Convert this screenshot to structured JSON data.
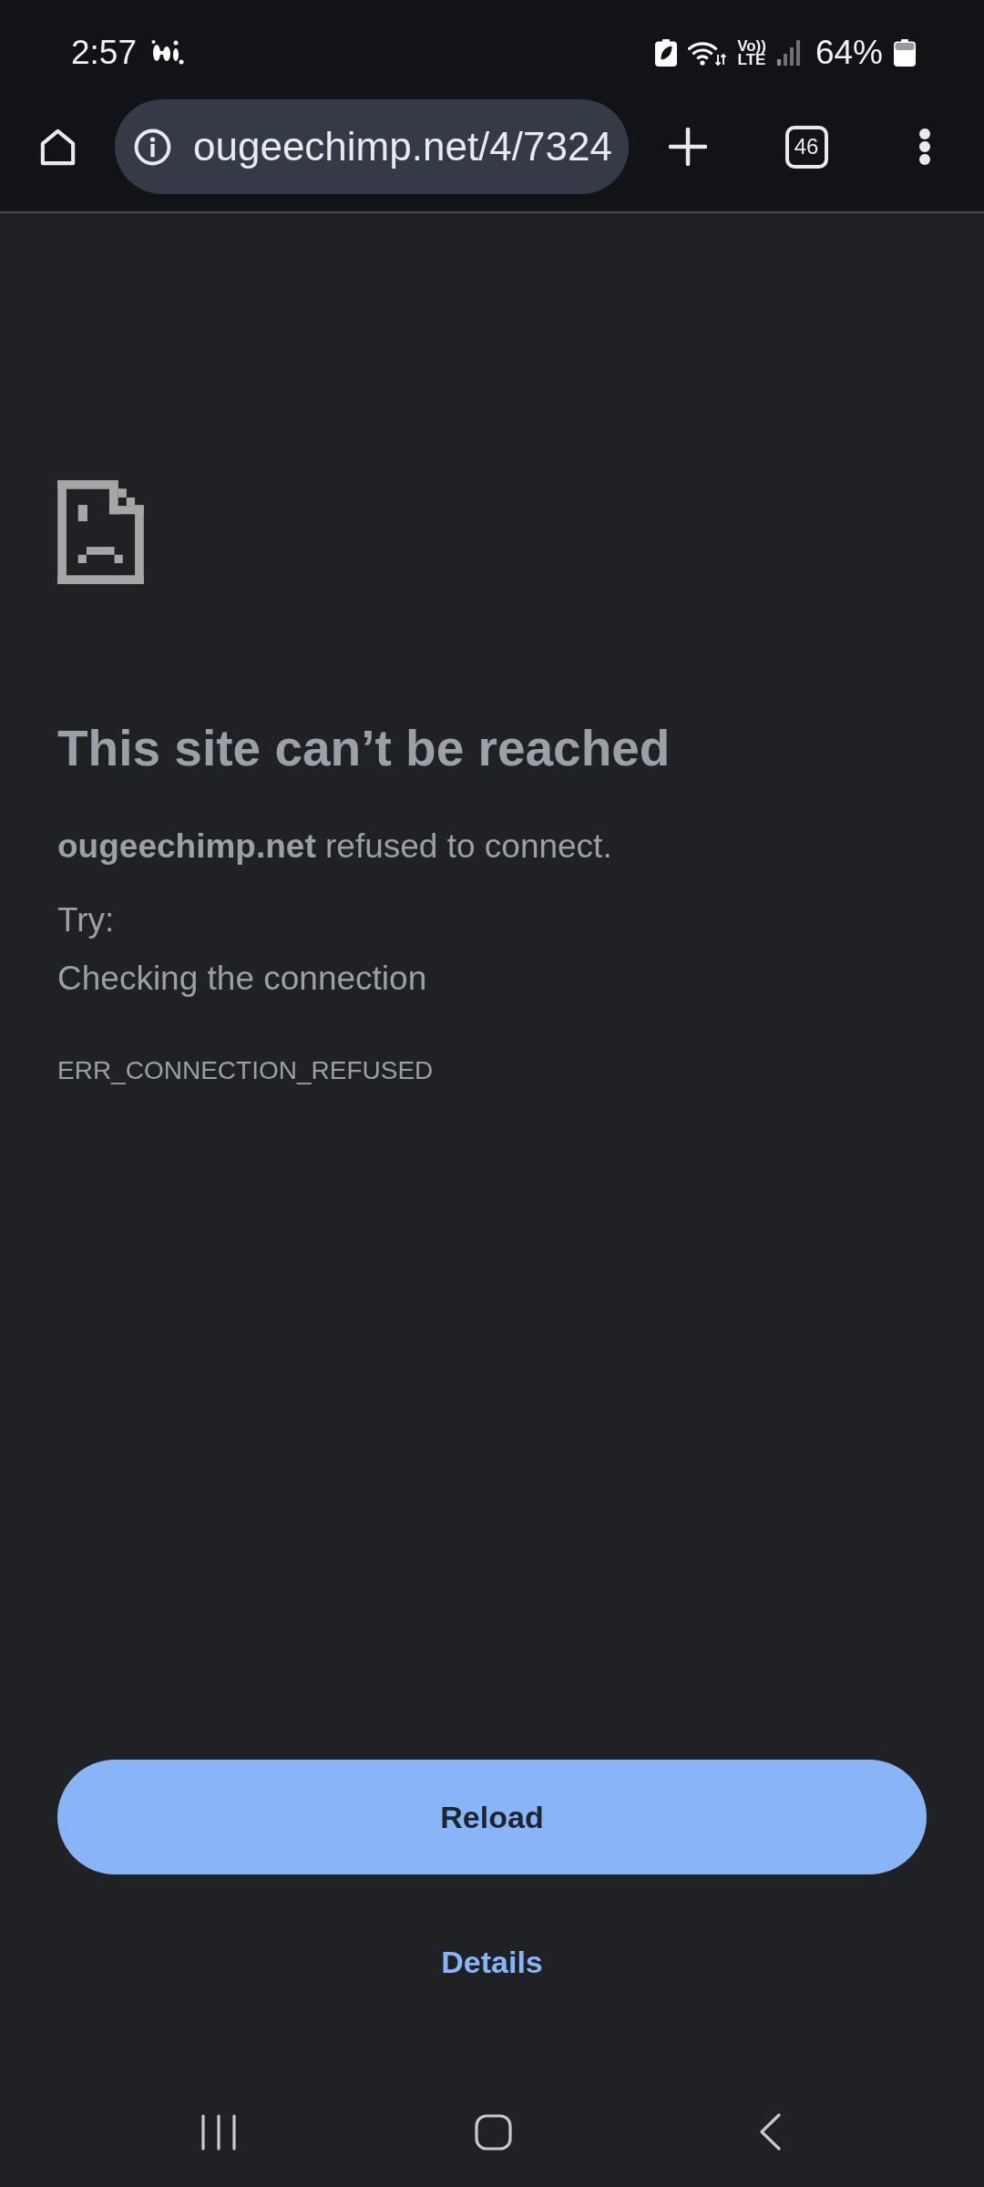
{
  "status_bar": {
    "time": "2:57",
    "network_indicator": {
      "voice": "Vo))",
      "type": "LTE"
    },
    "battery": "64%"
  },
  "toolbar": {
    "url": "ougeechimp.net/4/7324",
    "tab_count": "46"
  },
  "error_page": {
    "title": "This site can’t be reached",
    "message": "**ougeechimp.net** refused to connect.",
    "try_label": "Try:",
    "suggestions": [
      "Checking the connection"
    ],
    "error_code": "ERR_CONNECTION_REFUSED"
  },
  "actions": [
    {
      "kind": "primary",
      "label": "Reload"
    },
    {
      "kind": "link",
      "label": "Details"
    }
  ]
}
